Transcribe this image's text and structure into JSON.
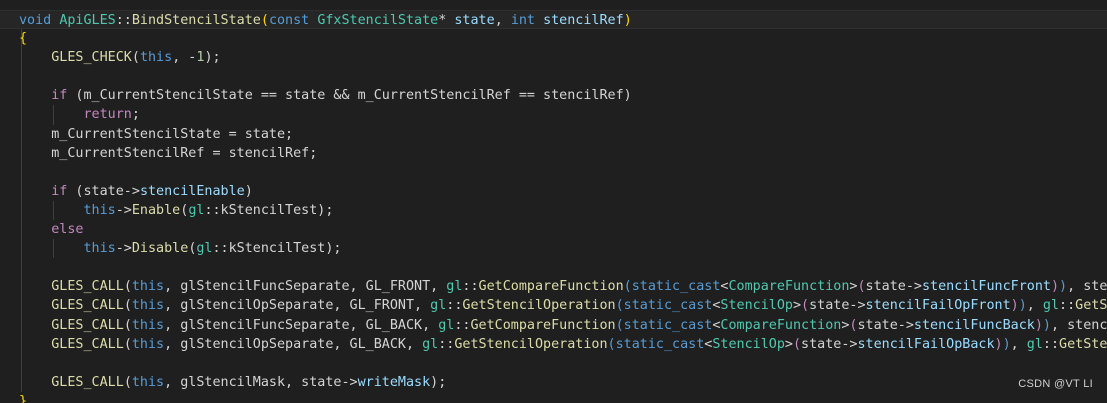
{
  "watermark": "CSDN @VT LI",
  "colors": {
    "background": "#1f1f1f",
    "keyword": "#569cd6",
    "control": "#c586c0",
    "function": "#dcdcaa",
    "type": "#4ec9b0",
    "variable": "#9cdcfe",
    "number": "#b5cea8",
    "plain": "#d4d4d4",
    "bracket": "#ffd700"
  },
  "code_lines": [
    [
      [
        "void",
        "kw"
      ],
      [
        " ",
        "op"
      ],
      [
        "ApiGLES",
        "type"
      ],
      [
        "::",
        "op"
      ],
      [
        "BindStencilState",
        "fn"
      ],
      [
        "(",
        "br"
      ],
      [
        "const",
        "kw"
      ],
      [
        " ",
        "op"
      ],
      [
        "GfxStencilState",
        "type"
      ],
      [
        "*",
        "op"
      ],
      [
        " ",
        "op"
      ],
      [
        "state",
        "var"
      ],
      [
        ", ",
        "op"
      ],
      [
        "int",
        "kw"
      ],
      [
        " ",
        "op"
      ],
      [
        "stencilRef",
        "var"
      ],
      [
        ")",
        "br"
      ]
    ],
    [
      [
        "{",
        "br"
      ]
    ],
    [
      [
        "    ",
        "op"
      ],
      [
        "GLES_CHECK",
        "macro"
      ],
      [
        "(",
        "op"
      ],
      [
        "this",
        "kw"
      ],
      [
        ", -",
        "op"
      ],
      [
        "1",
        "num"
      ],
      [
        ");",
        "op"
      ]
    ],
    [],
    [
      [
        "    ",
        "op"
      ],
      [
        "if",
        "ctl"
      ],
      [
        " (m_CurrentStencilState == state && m_CurrentStencilRef == stencilRef)",
        "op"
      ]
    ],
    [
      [
        "        ",
        "op"
      ],
      [
        "return",
        "ctl"
      ],
      [
        ";",
        "op"
      ]
    ],
    [
      [
        "    m_CurrentStencilState = state;",
        "op"
      ]
    ],
    [
      [
        "    m_CurrentStencilRef = stencilRef;",
        "op"
      ]
    ],
    [],
    [
      [
        "    ",
        "op"
      ],
      [
        "if",
        "ctl"
      ],
      [
        " (state->",
        "op"
      ],
      [
        "stencilEnable",
        "var"
      ],
      [
        ")",
        "op"
      ]
    ],
    [
      [
        "        ",
        "op"
      ],
      [
        "this",
        "kw"
      ],
      [
        "->",
        "op"
      ],
      [
        "Enable",
        "fn"
      ],
      [
        "(",
        "op"
      ],
      [
        "gl",
        "type"
      ],
      [
        "::kStencilTest);",
        "op"
      ]
    ],
    [
      [
        "    ",
        "op"
      ],
      [
        "else",
        "ctl"
      ]
    ],
    [
      [
        "        ",
        "op"
      ],
      [
        "this",
        "kw"
      ],
      [
        "->",
        "op"
      ],
      [
        "Disable",
        "fn"
      ],
      [
        "(",
        "op"
      ],
      [
        "gl",
        "type"
      ],
      [
        "::kStencilTest);",
        "op"
      ]
    ],
    [],
    [
      [
        "    ",
        "op"
      ],
      [
        "GLES_CALL",
        "macro"
      ],
      [
        "(",
        "op"
      ],
      [
        "this",
        "kw"
      ],
      [
        ", glStencilFuncSeparate, GL_FRONT, ",
        "op"
      ],
      [
        "gl",
        "type"
      ],
      [
        "::",
        "op"
      ],
      [
        "GetCompareFunction",
        "fn"
      ],
      [
        "(",
        "kw"
      ],
      [
        "static_cast",
        "kw"
      ],
      [
        "<",
        "op"
      ],
      [
        "CompareFunction",
        "type"
      ],
      [
        ">",
        "op"
      ],
      [
        "(",
        "ctl"
      ],
      [
        "state->",
        "op"
      ],
      [
        "stencilFuncFront",
        "var"
      ],
      [
        ")",
        "ctl"
      ],
      [
        ")",
        "kw"
      ],
      [
        ", stencilRef",
        "op"
      ]
    ],
    [
      [
        "    ",
        "op"
      ],
      [
        "GLES_CALL",
        "macro"
      ],
      [
        "(",
        "op"
      ],
      [
        "this",
        "kw"
      ],
      [
        ", glStencilOpSeparate, GL_FRONT, ",
        "op"
      ],
      [
        "gl",
        "type"
      ],
      [
        "::",
        "op"
      ],
      [
        "GetStencilOperation",
        "fn"
      ],
      [
        "(",
        "kw"
      ],
      [
        "static_cast",
        "kw"
      ],
      [
        "<",
        "op"
      ],
      [
        "StencilOp",
        "type"
      ],
      [
        ">",
        "op"
      ],
      [
        "(",
        "ctl"
      ],
      [
        "state->",
        "op"
      ],
      [
        "stencilFailOpFront",
        "var"
      ],
      [
        ")",
        "ctl"
      ],
      [
        ")",
        "kw"
      ],
      [
        ", ",
        "op"
      ],
      [
        "gl",
        "type"
      ],
      [
        "::",
        "op"
      ],
      [
        "GetStencilO",
        "fn"
      ]
    ],
    [
      [
        "    ",
        "op"
      ],
      [
        "GLES_CALL",
        "macro"
      ],
      [
        "(",
        "op"
      ],
      [
        "this",
        "kw"
      ],
      [
        ", glStencilFuncSeparate, GL_BACK, ",
        "op"
      ],
      [
        "gl",
        "type"
      ],
      [
        "::",
        "op"
      ],
      [
        "GetCompareFunction",
        "fn"
      ],
      [
        "(",
        "kw"
      ],
      [
        "static_cast",
        "kw"
      ],
      [
        "<",
        "op"
      ],
      [
        "CompareFunction",
        "type"
      ],
      [
        ">",
        "op"
      ],
      [
        "(",
        "ctl"
      ],
      [
        "state->",
        "op"
      ],
      [
        "stencilFuncBack",
        "var"
      ],
      [
        ")",
        "ctl"
      ],
      [
        ")",
        "kw"
      ],
      [
        ", stencilRef,",
        "op"
      ]
    ],
    [
      [
        "    ",
        "op"
      ],
      [
        "GLES_CALL",
        "macro"
      ],
      [
        "(",
        "op"
      ],
      [
        "this",
        "kw"
      ],
      [
        ", glStencilOpSeparate, GL_BACK, ",
        "op"
      ],
      [
        "gl",
        "type"
      ],
      [
        "::",
        "op"
      ],
      [
        "GetStencilOperation",
        "fn"
      ],
      [
        "(",
        "kw"
      ],
      [
        "static_cast",
        "kw"
      ],
      [
        "<",
        "op"
      ],
      [
        "StencilOp",
        "type"
      ],
      [
        ">",
        "op"
      ],
      [
        "(",
        "ctl"
      ],
      [
        "state->",
        "op"
      ],
      [
        "stencilFailOpBack",
        "var"
      ],
      [
        ")",
        "ctl"
      ],
      [
        ")",
        "kw"
      ],
      [
        ", ",
        "op"
      ],
      [
        "gl",
        "type"
      ],
      [
        "::",
        "op"
      ],
      [
        "GetStencilOpe",
        "fn"
      ]
    ],
    [],
    [
      [
        "    ",
        "op"
      ],
      [
        "GLES_CALL",
        "macro"
      ],
      [
        "(",
        "op"
      ],
      [
        "this",
        "kw"
      ],
      [
        ", glStencilMask, state->",
        "op"
      ],
      [
        "writeMask",
        "var"
      ],
      [
        ");",
        "op"
      ]
    ],
    [
      [
        "}",
        "br"
      ]
    ]
  ]
}
